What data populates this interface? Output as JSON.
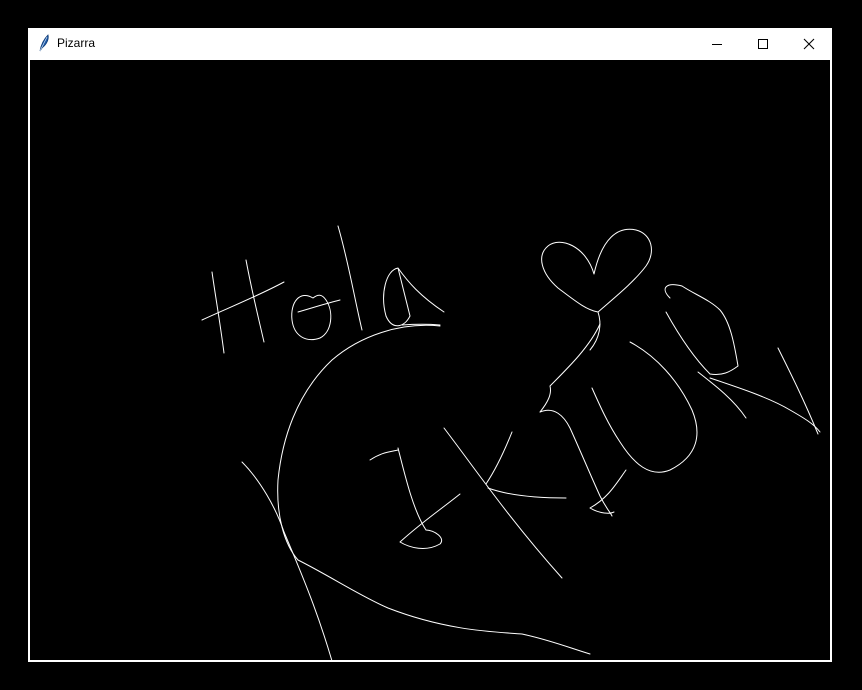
{
  "window": {
    "title": "Pizarra",
    "icon": "feather-icon",
    "controls": [
      "minimize-icon",
      "maximize-icon",
      "close-icon"
    ]
  },
  "canvas": {
    "background": "#000000",
    "stroke_color": "#ffffff"
  }
}
